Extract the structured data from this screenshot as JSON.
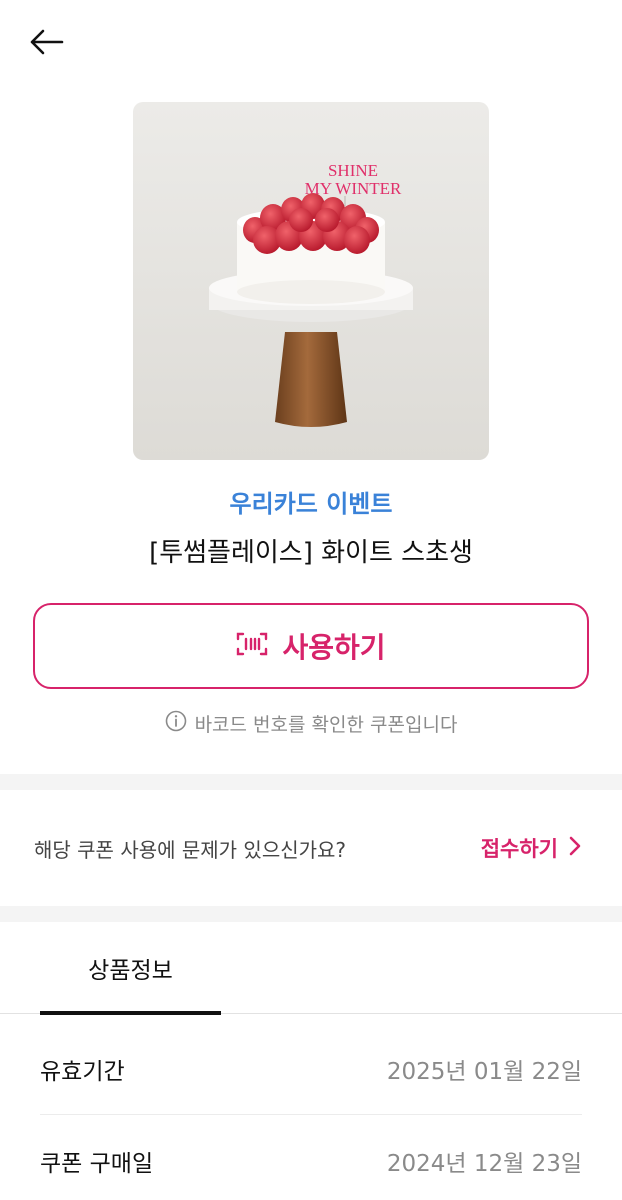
{
  "header": {
    "back_icon": "arrow-left-icon"
  },
  "product": {
    "image_text_line1": "SHINE",
    "image_text_line2": "MY WINTER",
    "brand": "우리카드 이벤트",
    "name": "[투썸플레이스] 화이트 스초생"
  },
  "actions": {
    "use_label": "사용하기",
    "use_icon": "barcode-scan-icon",
    "accent_color": "#d7236a"
  },
  "notice": {
    "icon": "info-circle-icon",
    "text": "바코드 번호를 확인한 쿠폰입니다"
  },
  "report": {
    "question": "해당 쿠폰 사용에 문제가 있으신가요?",
    "link_label": "접수하기",
    "link_icon": "chevron-right-icon"
  },
  "tabs": [
    {
      "label": "상품정보",
      "selected": true
    }
  ],
  "info": {
    "rows": [
      {
        "label": "유효기간",
        "value": "2025년 01월 22일"
      },
      {
        "label": "쿠폰 구매일",
        "value": "2024년 12월 23일"
      }
    ]
  }
}
